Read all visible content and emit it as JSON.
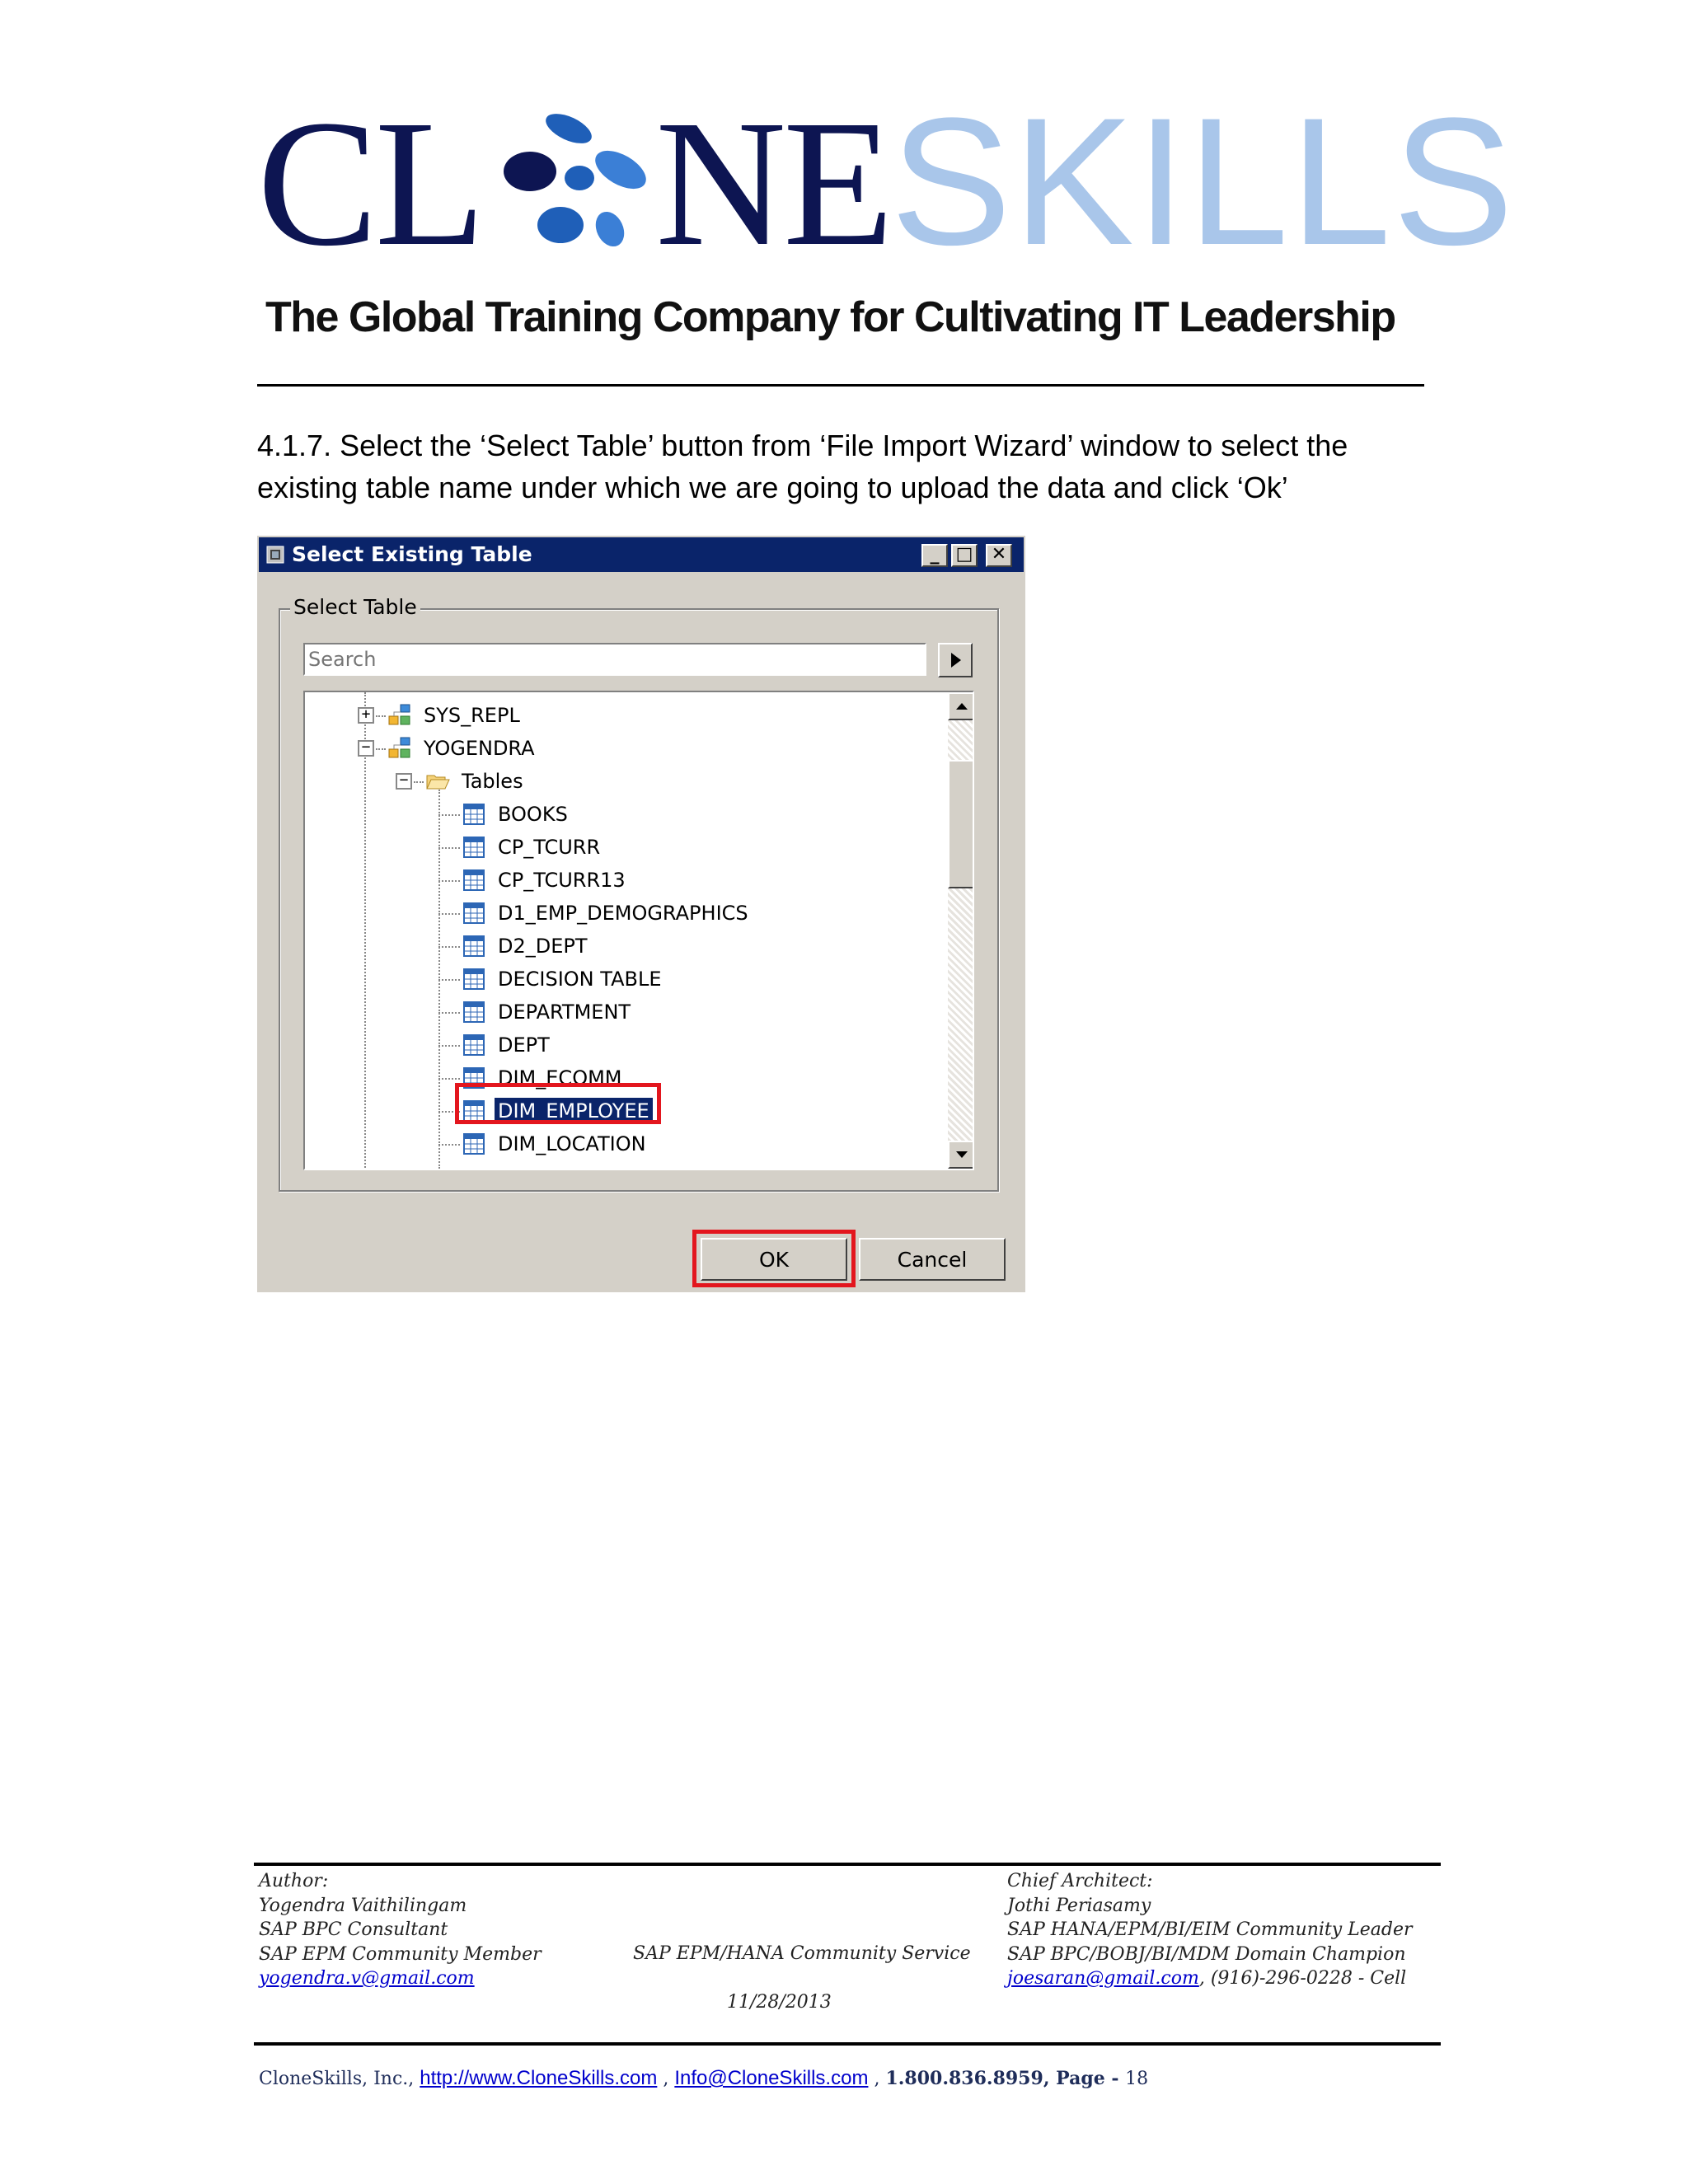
{
  "header": {
    "logo_part1": "CL",
    "logo_part2": "NE",
    "logo_part3": "SKILLS",
    "tagline": "The Global Training Company for Cultivating IT Leadership",
    "colors": {
      "logo_dark": "#0d1552",
      "logo_light": "#a9c6ea",
      "logo_dots": "#1f5fb8"
    }
  },
  "step": {
    "text": "4.1.7. Select the ‘Select Table’ button from ‘File Import Wizard’ window to select the existing table name under which we are going to upload the data and click ‘Ok’"
  },
  "dialog": {
    "title": "Select Existing Table",
    "window_buttons": {
      "minimize": "_",
      "maximize": "□",
      "close": "✕"
    },
    "group_label": "Select Table",
    "search_placeholder": "Search",
    "tree": [
      {
        "label": "SYS_REPL",
        "level": 1,
        "icon": "schema-icon",
        "expander": "+"
      },
      {
        "label": "YOGENDRA",
        "level": 1,
        "icon": "schema-icon",
        "expander": "−"
      },
      {
        "label": "Tables",
        "level": 2,
        "icon": "folder-icon",
        "expander": "−"
      },
      {
        "label": "BOOKS",
        "level": 3,
        "icon": "table-icon"
      },
      {
        "label": "CP_TCURR",
        "level": 3,
        "icon": "table-icon"
      },
      {
        "label": "CP_TCURR13",
        "level": 3,
        "icon": "table-icon"
      },
      {
        "label": "D1_EMP_DEMOGRAPHICS",
        "level": 3,
        "icon": "table-icon"
      },
      {
        "label": "D2_DEPT",
        "level": 3,
        "icon": "table-icon"
      },
      {
        "label": "DECISION TABLE",
        "level": 3,
        "icon": "table-icon"
      },
      {
        "label": "DEPARTMENT",
        "level": 3,
        "icon": "table-icon"
      },
      {
        "label": "DEPT",
        "level": 3,
        "icon": "table-icon"
      },
      {
        "label": "DIM_ECOMM",
        "level": 3,
        "icon": "table-icon"
      },
      {
        "label": "DIM_EMPLOYEE",
        "level": 3,
        "icon": "table-icon",
        "selected": true
      },
      {
        "label": "DIM_LOCATION",
        "level": 3,
        "icon": "table-icon"
      }
    ],
    "ok_label": "OK",
    "cancel_label": "Cancel",
    "colors": {
      "titlebar": "#0a246a",
      "face": "#d4d0c8",
      "selection": "#0a246a",
      "highlight_box": "#e3161e"
    }
  },
  "footer": {
    "left": {
      "line1": "Author:",
      "line2": "Yogendra Vaithilingam",
      "line3": "SAP BPC Consultant",
      "line4": "SAP EPM Community Member",
      "email": "yogendra.v@gmail.com"
    },
    "center": {
      "service": "SAP EPM/HANA Community Service",
      "date": "11/28/2013"
    },
    "right": {
      "line1": "Chief Architect:",
      "line2": "Jothi Periasamy",
      "line3": "SAP HANA/EPM/BI/EIM Community Leader",
      "line4": "SAP BPC/BOBJ/BI/MDM Domain Champion",
      "email": "joesaran@gmail.com",
      "phone": ", (916)-296-0228 - Cell"
    },
    "bottom": {
      "company": "CloneSkills, Inc., ",
      "website": "http://www.CloneSkills.com",
      "sep1": " , ",
      "info_email": "Info@CloneSkills.com",
      "sep2": " , ",
      "phone": "1.800.836.8959",
      "page_prefix": ", Page - ",
      "page_number": "18"
    }
  }
}
